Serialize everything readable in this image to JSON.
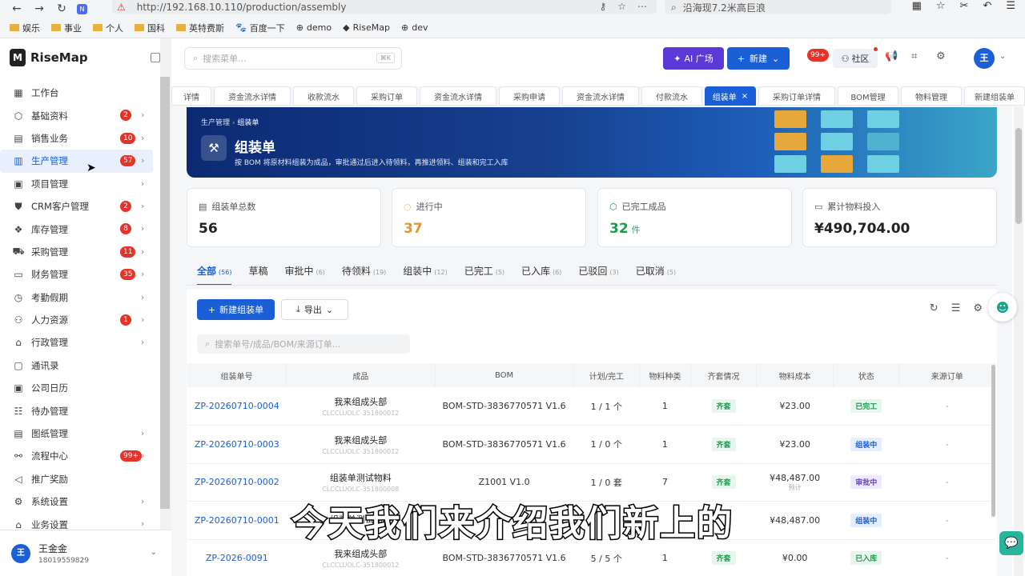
{
  "browser": {
    "url": "http://192.168.10.110/production/assembly",
    "search_text": "沿海现7.2米高巨浪",
    "bookmarks": [
      "娱乐",
      "事业",
      "个人",
      "国科",
      "英特费斯",
      "百度一下",
      "demo",
      "RiseMap",
      "dev"
    ]
  },
  "app": {
    "name": "RiseMap"
  },
  "header": {
    "search_placeholder": "搜索菜单...",
    "search_shortcut": "⌘K",
    "ai_label": "AI 广场",
    "new_label": "新建",
    "notif_badge": "99+",
    "community_label": "社区",
    "avatar_initial": "王"
  },
  "sidebar": {
    "items": [
      {
        "label": "工作台",
        "icon": "grid-icon",
        "badge": "",
        "chev": false
      },
      {
        "label": "基础资料",
        "icon": "box-icon",
        "badge": "2",
        "chev": true
      },
      {
        "label": "销售业务",
        "icon": "doc-icon",
        "badge": "10",
        "chev": true
      },
      {
        "label": "生产管理",
        "icon": "chart-icon",
        "badge": "57",
        "chev": true,
        "active": true
      },
      {
        "label": "项目管理",
        "icon": "calendar-icon",
        "badge": "",
        "chev": true
      },
      {
        "label": "CRM客户管理",
        "icon": "handshake-icon",
        "badge": "2",
        "chev": true
      },
      {
        "label": "库存管理",
        "icon": "stack-icon",
        "badge": "8",
        "chev": true
      },
      {
        "label": "采购管理",
        "icon": "cart-icon",
        "badge": "11",
        "chev": true
      },
      {
        "label": "财务管理",
        "icon": "wallet-icon",
        "badge": "35",
        "chev": true
      },
      {
        "label": "考勤假期",
        "icon": "clock-icon",
        "badge": "",
        "chev": true
      },
      {
        "label": "人力资源",
        "icon": "people-icon",
        "badge": "1",
        "chev": true
      },
      {
        "label": "行政管理",
        "icon": "building-icon",
        "badge": "",
        "chev": true
      },
      {
        "label": "通讯录",
        "icon": "contact-icon",
        "badge": "",
        "chev": false
      },
      {
        "label": "公司日历",
        "icon": "calendar-icon",
        "badge": "",
        "chev": false
      },
      {
        "label": "待办管理",
        "icon": "checklist-icon",
        "badge": "",
        "chev": false
      },
      {
        "label": "图纸管理",
        "icon": "doc-icon",
        "badge": "",
        "chev": true
      },
      {
        "label": "流程中心",
        "icon": "flow-icon",
        "badge": "99+",
        "chev": true
      },
      {
        "label": "推广奖励",
        "icon": "megaphone-icon",
        "badge": "",
        "chev": false
      },
      {
        "label": "系统设置",
        "icon": "gear-icon",
        "badge": "",
        "chev": true
      },
      {
        "label": "业务设置",
        "icon": "building-icon",
        "badge": "",
        "chev": true
      }
    ],
    "user_name": "王金金",
    "user_phone": "18019559829",
    "user_initial": "王"
  },
  "tabs": [
    "详情",
    "资金流水详情",
    "收款流水",
    "采购订单",
    "资金流水详情",
    "采购申请",
    "资金流水详情",
    "付款流水",
    "组装单",
    "采购订单详情",
    "BOM管理",
    "物料管理",
    "新建组装单"
  ],
  "banner": {
    "crumb_parent": "生产管理",
    "crumb_current": "组装单",
    "title": "组装单",
    "desc": "按 BOM 将原材料组装为成品，审批通过后进入待领料，再推进领料、组装和完工入库"
  },
  "stats": [
    {
      "label": "组装单总数",
      "value": "56",
      "unit": "",
      "color": "#222222"
    },
    {
      "label": "进行中",
      "value": "37",
      "unit": "",
      "color": "#e6962a"
    },
    {
      "label": "已完工成品",
      "value": "32",
      "unit": "件",
      "color": "#1e9a4e"
    },
    {
      "label": "累计物料投入",
      "value": "¥490,704.00",
      "unit": "",
      "color": "#222222"
    }
  ],
  "filter_tabs": [
    {
      "label": "全部",
      "count": "(56)"
    },
    {
      "label": "草稿",
      "count": ""
    },
    {
      "label": "审批中",
      "count": "(6)"
    },
    {
      "label": "待领料",
      "count": "(19)"
    },
    {
      "label": "组装中",
      "count": "(12)"
    },
    {
      "label": "已完工",
      "count": "(5)"
    },
    {
      "label": "已入库",
      "count": "(6)"
    },
    {
      "label": "已驳回",
      "count": "(3)"
    },
    {
      "label": "已取消",
      "count": "(5)"
    }
  ],
  "toolbar": {
    "create_label": "新建组装单",
    "export_label": "导出",
    "search_placeholder": "搜索单号/成品/BOM/来源订单..."
  },
  "table": {
    "headers": [
      "组装单号",
      "成品",
      "BOM",
      "计划/完工",
      "物料种类",
      "齐套情况",
      "物料成本",
      "状态",
      "来源订单"
    ],
    "rows": [
      {
        "code": "ZP-20260710-0004",
        "product": "我来组成头部",
        "product_code": "CLCCLUOLC-351800012",
        "bom": "BOM-STD-3836770571 V1.6",
        "plan": "1 / 1 个",
        "kinds": "1",
        "kit": "齐套",
        "cost": "¥23.00",
        "cost_sub": "",
        "status": "已完工",
        "status_color": "green",
        "source": "-"
      },
      {
        "code": "ZP-20260710-0003",
        "product": "我来组成头部",
        "product_code": "CLCCLUOLC-351800012",
        "bom": "BOM-STD-3836770571 V1.6",
        "plan": "1 / 0 个",
        "kinds": "1",
        "kit": "齐套",
        "cost": "¥23.00",
        "cost_sub": "",
        "status": "组装中",
        "status_color": "blue",
        "source": "-"
      },
      {
        "code": "ZP-20260710-0002",
        "product": "组装单测试物料",
        "product_code": "CLCCLUOLC-351800008",
        "bom": "Z1001 V1.0",
        "plan": "1 / 0 套",
        "kinds": "7",
        "kit": "齐套",
        "cost": "¥48,487.00",
        "cost_sub": "预计",
        "status": "审批中",
        "status_color": "purple",
        "source": "-"
      },
      {
        "code": "ZP-20260710-0001",
        "product": "组装单测试物料",
        "product_code": "",
        "bom": "",
        "plan": "",
        "kinds": "",
        "kit": "",
        "cost": "¥48,487.00",
        "cost_sub": "",
        "status": "组装中",
        "status_color": "blue",
        "source": "-"
      },
      {
        "code": "ZP-2026-0091",
        "product": "我来组成头部",
        "product_code": "CLCCLUOLC-351800012",
        "bom": "BOM-STD-3836770571 V1.6",
        "plan": "5 / 5 个",
        "kinds": "1",
        "kit": "齐套",
        "cost": "¥0.00",
        "cost_sub": "",
        "status": "已入库",
        "status_color": "green",
        "source": "-"
      }
    ]
  },
  "caption": "今天我们来介绍我们新上的"
}
